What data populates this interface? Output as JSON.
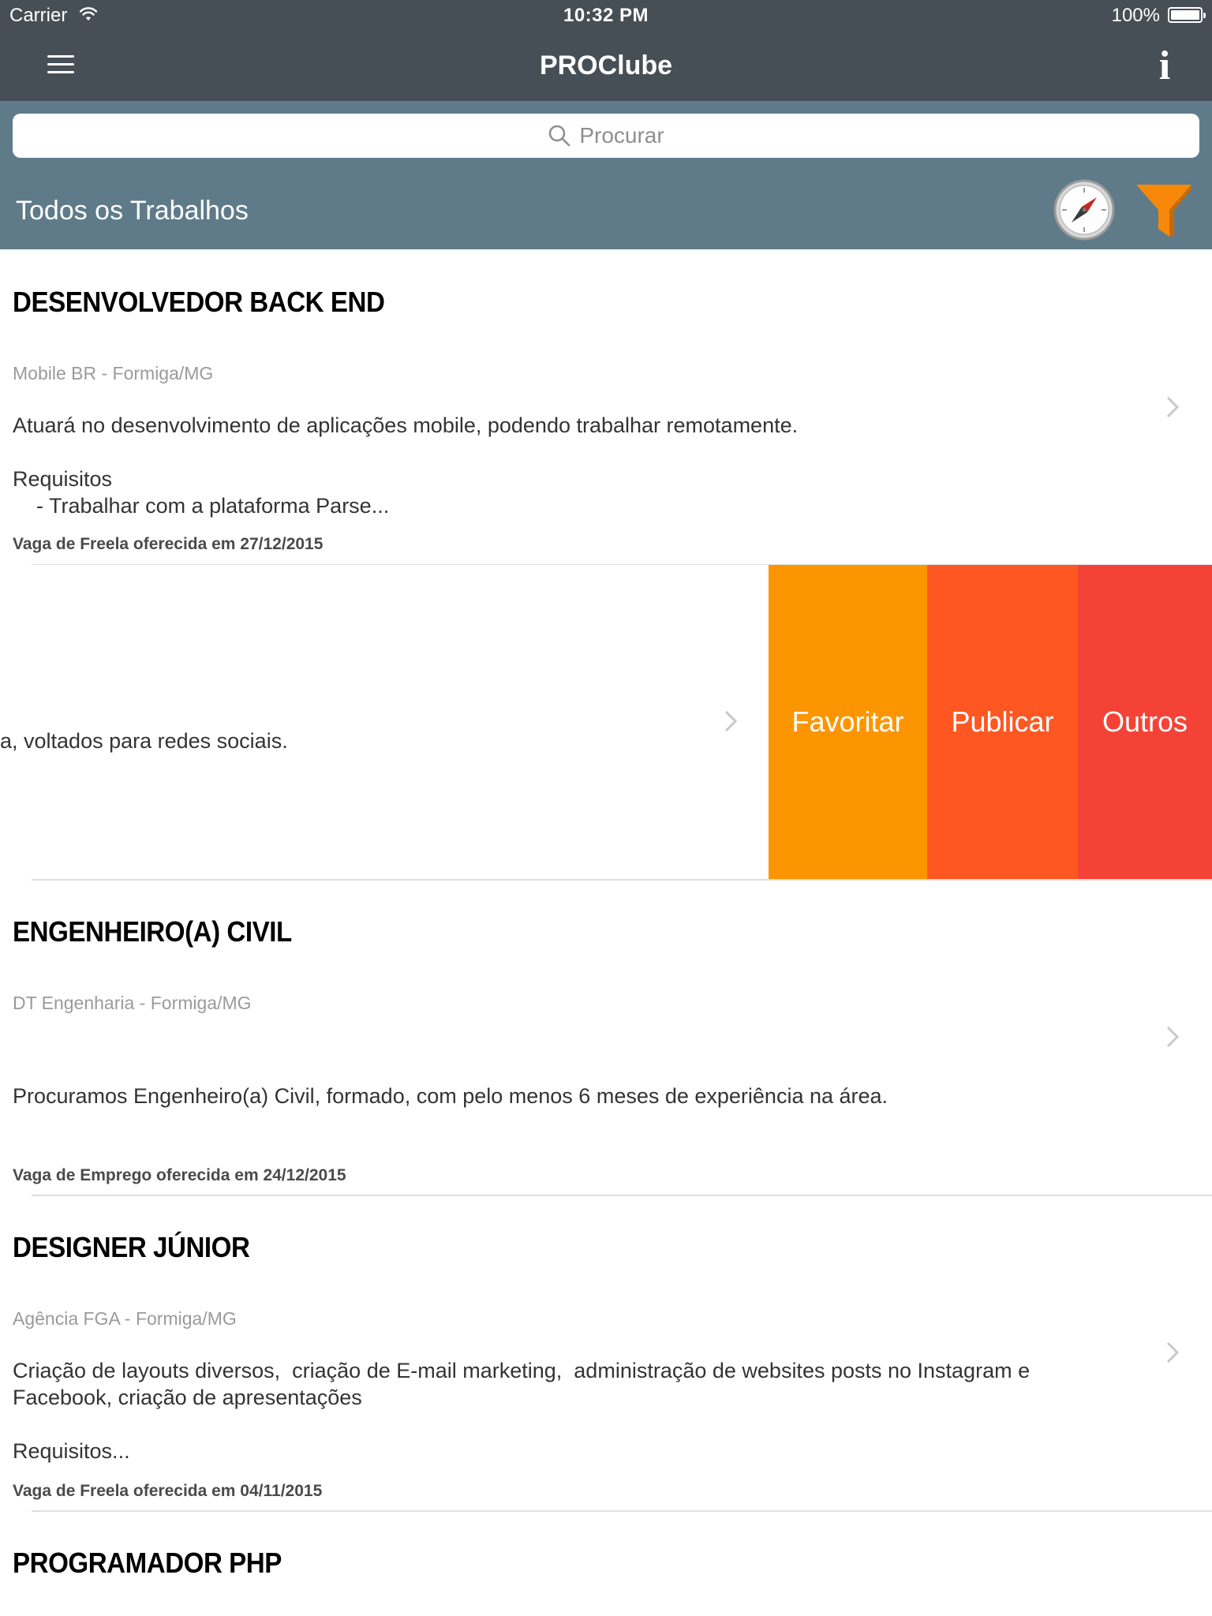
{
  "status_bar": {
    "carrier": "Carrier",
    "time": "10:32 PM",
    "battery": "100%"
  },
  "nav": {
    "title": "PROClube",
    "info_label": "i"
  },
  "search": {
    "placeholder": "Procurar"
  },
  "section": {
    "title": "Todos os Trabalhos"
  },
  "colors": {
    "nav_bg": "#474f56",
    "header_bg": "#5f7b89",
    "favoritar": "#fd9500",
    "publicar": "#fe5722",
    "outros": "#f44336",
    "filter": "#f7890a"
  },
  "jobs": [
    {
      "title": "DESENVOLVEDOR BACK END",
      "company": "Mobile BR - Formiga/MG",
      "description": "Atuará no desenvolvimento de aplicações mobile, podendo trabalhar remotamente.\n\nRequisitos\n    - Trabalhar com a plataforma Parse...",
      "footer": "Vaga de Freela oferecida em 27/12/2015"
    },
    {
      "description_partial": "a, voltados para redes sociais."
    },
    {
      "title": "ENGENHEIRO(A) CIVIL",
      "company": "DT Engenharia - Formiga/MG",
      "description": "Procuramos Engenheiro(a) Civil, formado, com pelo menos 6 meses de experiência na área.",
      "footer": "Vaga de Emprego oferecida em 24/12/2015"
    },
    {
      "title": "DESIGNER JÚNIOR",
      "company": "Agência FGA - Formiga/MG",
      "description": "Criação de layouts diversos,  criação de E-mail marketing,  administração de websites posts no Instagram e\nFacebook, criação de apresentações\n\nRequisitos...",
      "footer": "Vaga de Freela oferecida em 04/11/2015"
    },
    {
      "title": "PROGRAMADOR PHP"
    }
  ],
  "swipe_actions": {
    "favoritar": "Favoritar",
    "publicar": "Publicar",
    "outros": "Outros"
  }
}
